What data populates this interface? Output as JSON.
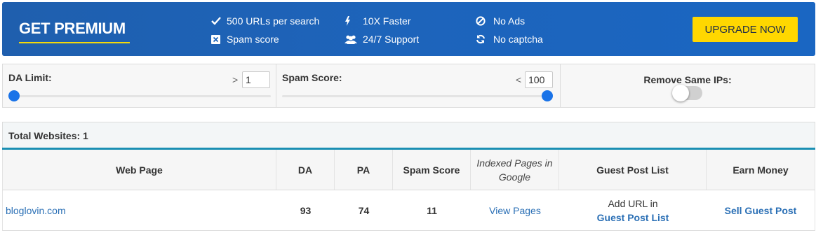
{
  "banner": {
    "title": "GET PREMIUM",
    "features": [
      {
        "icon": "check-icon",
        "label": "500 URLs per search"
      },
      {
        "icon": "spam-box-icon",
        "label": "Spam score"
      },
      {
        "icon": "bolt-icon",
        "label": "10X Faster"
      },
      {
        "icon": "users-icon",
        "label": "24/7 Support"
      },
      {
        "icon": "no-ads-icon",
        "label": "No Ads"
      },
      {
        "icon": "refresh-icon",
        "label": "No captcha"
      }
    ],
    "upgrade_label": "UPGRADE NOW",
    "colors": {
      "background": "#1d64bb",
      "accent": "#ffd700"
    }
  },
  "filters": {
    "da_limit": {
      "label": "DA Limit:",
      "sign": ">",
      "value": "1",
      "slider_fraction": 0.0
    },
    "spam_score": {
      "label": "Spam Score:",
      "sign": "<",
      "value": "100",
      "slider_fraction": 1.0
    },
    "remove_same_ips": {
      "label": "Remove Same IPs:",
      "enabled": false
    }
  },
  "summary": {
    "total_label": "Total Websites: 1"
  },
  "table": {
    "headers": [
      "Web Page",
      "DA",
      "PA",
      "Spam Score",
      "Indexed Pages in Google",
      "Guest Post List",
      "Earn Money"
    ],
    "rows": [
      {
        "web_page": "bloglovin.com",
        "da": "93",
        "pa": "74",
        "spam_score": "11",
        "indexed_link": "View Pages",
        "guest_post_prefix": "Add URL in",
        "guest_post_link": "Guest Post List",
        "earn_money_link": "Sell Guest Post"
      }
    ]
  }
}
